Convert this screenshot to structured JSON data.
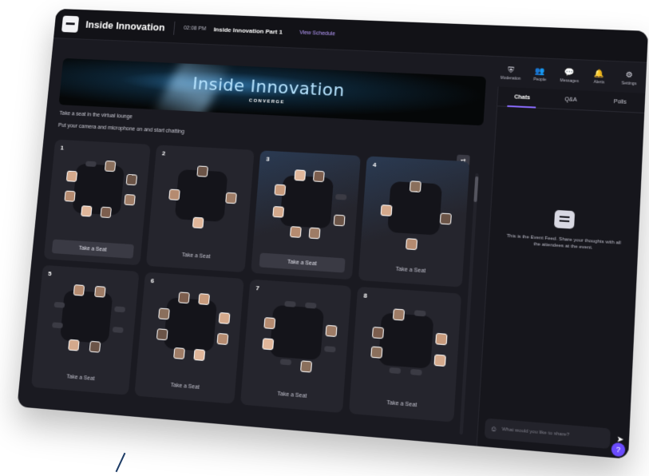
{
  "header": {
    "brand": "Inside Innovation",
    "time": "02:08 PM",
    "session": "Inside Innovation Part 1",
    "schedule_link": "View Schedule"
  },
  "nav": [
    {
      "icon": "shield-icon",
      "glyph": "⛨",
      "label": "Moderation"
    },
    {
      "icon": "people-icon",
      "glyph": "👥",
      "label": "People"
    },
    {
      "icon": "messages-icon",
      "glyph": "💬",
      "label": "Messages"
    },
    {
      "icon": "bell-icon",
      "glyph": "🔔",
      "label": "Alerts"
    },
    {
      "icon": "gear-icon",
      "glyph": "⚙",
      "label": "Settings"
    }
  ],
  "banner": {
    "title": "Inside Innovation",
    "subtitle": "CONVERGE"
  },
  "lounge": {
    "title": "Take a seat in the virtual lounge",
    "subtitle": "Put your camera and microphone on and start chatting"
  },
  "tables": [
    {
      "number": "1",
      "button": "Take a Seat",
      "button_active": true,
      "highlight": false
    },
    {
      "number": "2",
      "button": "Take a Seat",
      "button_active": false,
      "highlight": false
    },
    {
      "number": "3",
      "button": "Take a Seat",
      "button_active": true,
      "highlight": true
    },
    {
      "number": "4",
      "button": "Take a Seat",
      "button_active": false,
      "highlight": true
    },
    {
      "number": "5",
      "button": "Take a Seat",
      "button_active": false,
      "highlight": false
    },
    {
      "number": "6",
      "button": "Take a Seat",
      "button_active": false,
      "highlight": false
    },
    {
      "number": "7",
      "button": "Take a Seat",
      "button_active": false,
      "highlight": false
    },
    {
      "number": "8",
      "button": "Take a Seat",
      "button_active": false,
      "highlight": false
    }
  ],
  "sidebar": {
    "tabs": [
      "Chats",
      "Q&A",
      "Polls"
    ],
    "active_tab": "Chats",
    "feed_empty": "This is the Event Feed. Share your thoughts with all the attendees at the event.",
    "chat_placeholder": "What would you like to share?"
  },
  "colors": {
    "accent": "#8b6cff",
    "background": "#1a1a21",
    "card": "#25252d"
  }
}
